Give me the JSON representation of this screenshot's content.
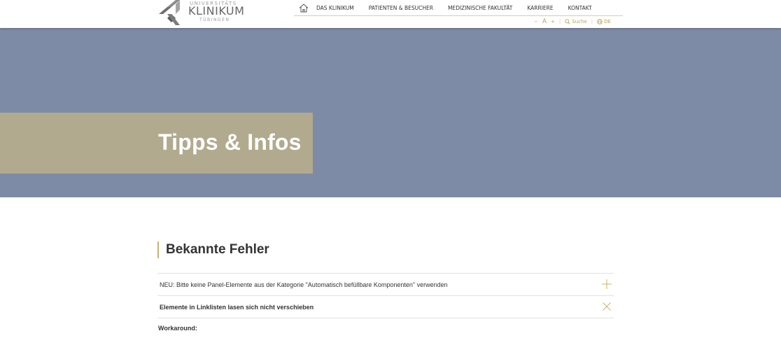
{
  "header": {
    "logo": {
      "line1": "UNIVERSITÄTS",
      "line2": "KLINIKUM",
      "line3": "TÜBINGEN",
      "icon": "arrow-chevron-logo"
    },
    "nav": {
      "home_icon": "home-icon",
      "items": [
        {
          "label": "DAS KLINIKUM"
        },
        {
          "label": "PATIENTEN & BESUCHER"
        },
        {
          "label": "MEDIZINISCHE FAKULTÄT"
        },
        {
          "label": "KARRIERE"
        },
        {
          "label": "KONTAKT"
        }
      ]
    },
    "tools": {
      "decrease": "−",
      "font": "A",
      "increase": "+",
      "search_label": "Suche",
      "language": "DE"
    }
  },
  "hero": {
    "title": "Tipps & Infos",
    "bg_color": "#7e8ba6",
    "box_color": "#b2aa8e"
  },
  "main": {
    "heading": "Bekannte Fehler",
    "accent_color": "#c9b26b",
    "accordion": [
      {
        "label": "NEU: Bitte keine Panel-Elemente aus der Kategorie \"Automatisch befüllbare Komponenten\" verwenden",
        "icon": "plus-icon",
        "expanded": false
      },
      {
        "label": "Elemente in Linklisten lasen sich nicht verschieben",
        "icon": "close-icon",
        "expanded": true
      }
    ],
    "workaround_label": "Workaround:"
  }
}
